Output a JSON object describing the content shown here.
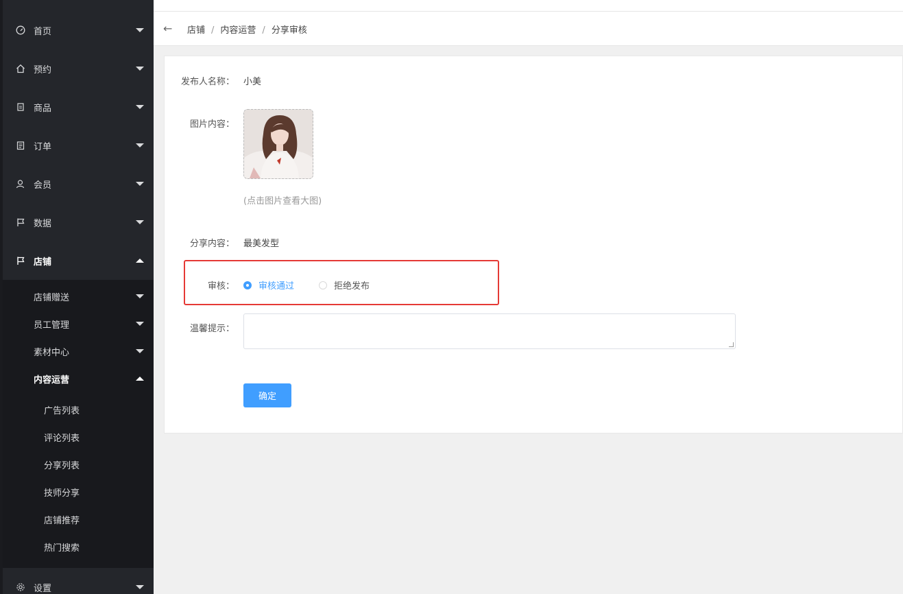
{
  "sidebar": {
    "top_items": [
      {
        "label": "首页",
        "icon": "dashboard-icon"
      },
      {
        "label": "预约",
        "icon": "home-icon"
      },
      {
        "label": "商品",
        "icon": "document-icon"
      },
      {
        "label": "订单",
        "icon": "clipboard-icon"
      },
      {
        "label": "会员",
        "icon": "user-icon"
      },
      {
        "label": "数据",
        "icon": "flag-icon"
      },
      {
        "label": "店铺",
        "icon": "flag-icon"
      }
    ],
    "sub_items": [
      "店铺赠送",
      "员工管理",
      "素材中心",
      "内容运营"
    ],
    "leaf_items": [
      "广告列表",
      "评论列表",
      "分享列表",
      "技师分享",
      "店铺推荐",
      "热门搜索"
    ],
    "settings_label": "设置"
  },
  "breadcrumb": {
    "items": [
      "店铺",
      "内容运营",
      "分享审核"
    ],
    "separator": "/"
  },
  "form": {
    "publisher_label": "发布人名称：",
    "publisher_value": "小美",
    "image_label": "图片内容：",
    "image_hint": "(点击图片查看大图)",
    "share_label": "分享内容：",
    "share_value": "最美发型",
    "review_label": "审核：",
    "review_options": [
      {
        "label": "审核通过",
        "checked": true
      },
      {
        "label": "拒绝发布",
        "checked": false
      }
    ],
    "tip_label": "温馨提示：",
    "tip_value": "",
    "confirm_label": "确定"
  },
  "colors": {
    "accent": "#409eff",
    "sidebar_bg": "#24262b",
    "highlight": "#e53935"
  }
}
